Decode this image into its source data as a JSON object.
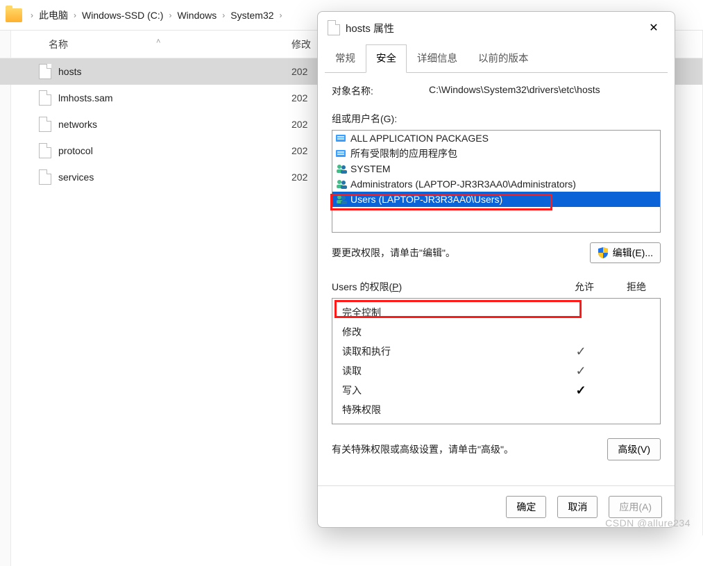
{
  "breadcrumb": {
    "items": [
      "此电脑",
      "Windows-SSD (C:)",
      "Windows",
      "System32"
    ]
  },
  "filelist": {
    "columns": {
      "name": "名称",
      "modified": "修改"
    },
    "rows": [
      {
        "name": "hosts",
        "date": "202",
        "selected": true
      },
      {
        "name": "lmhosts.sam",
        "date": "202",
        "selected": false
      },
      {
        "name": "networks",
        "date": "202",
        "selected": false
      },
      {
        "name": "protocol",
        "date": "202",
        "selected": false
      },
      {
        "name": "services",
        "date": "202",
        "selected": false
      }
    ]
  },
  "dialog": {
    "title": "hosts 属性",
    "tabs": {
      "general": "常规",
      "security": "安全",
      "details": "详细信息",
      "previous": "以前的版本",
      "active": "security"
    },
    "object_label": "对象名称:",
    "object_value": "C:\\Windows\\System32\\drivers\\etc\\hosts",
    "groups_label": "组或用户名(G):",
    "groups": [
      {
        "icon": "pkg",
        "label": "ALL APPLICATION PACKAGES"
      },
      {
        "icon": "pkg",
        "label": "所有受限制的应用程序包"
      },
      {
        "icon": "users",
        "label": "SYSTEM"
      },
      {
        "icon": "users",
        "label": "Administrators (LAPTOP-JR3R3AA0\\Administrators)"
      },
      {
        "icon": "users",
        "label": "Users (LAPTOP-JR3R3AA0\\Users)",
        "selected": true
      }
    ],
    "edit_hint": "要更改权限，请单击\"编辑\"。",
    "edit_button": "编辑(E)...",
    "perm_label_prefix": "Users 的权限(",
    "perm_label_suffix": ")",
    "perm_label_u": "P",
    "perm_allow": "允许",
    "perm_deny": "拒绝",
    "permissions": [
      {
        "name": "完全控制",
        "allow": "",
        "deny": ""
      },
      {
        "name": "修改",
        "allow": "",
        "deny": "",
        "highlight": true
      },
      {
        "name": "读取和执行",
        "allow": "check",
        "deny": ""
      },
      {
        "name": "读取",
        "allow": "check",
        "deny": ""
      },
      {
        "name": "写入",
        "allow": "strong",
        "deny": ""
      },
      {
        "name": "特殊权限",
        "allow": "",
        "deny": ""
      }
    ],
    "advanced_hint": "有关特殊权限或高级设置，请单击\"高级\"。",
    "advanced_button": "高级(V)",
    "ok": "确定",
    "cancel": "取消",
    "apply": "应用(A)"
  },
  "watermark": "CSDN @allure234"
}
